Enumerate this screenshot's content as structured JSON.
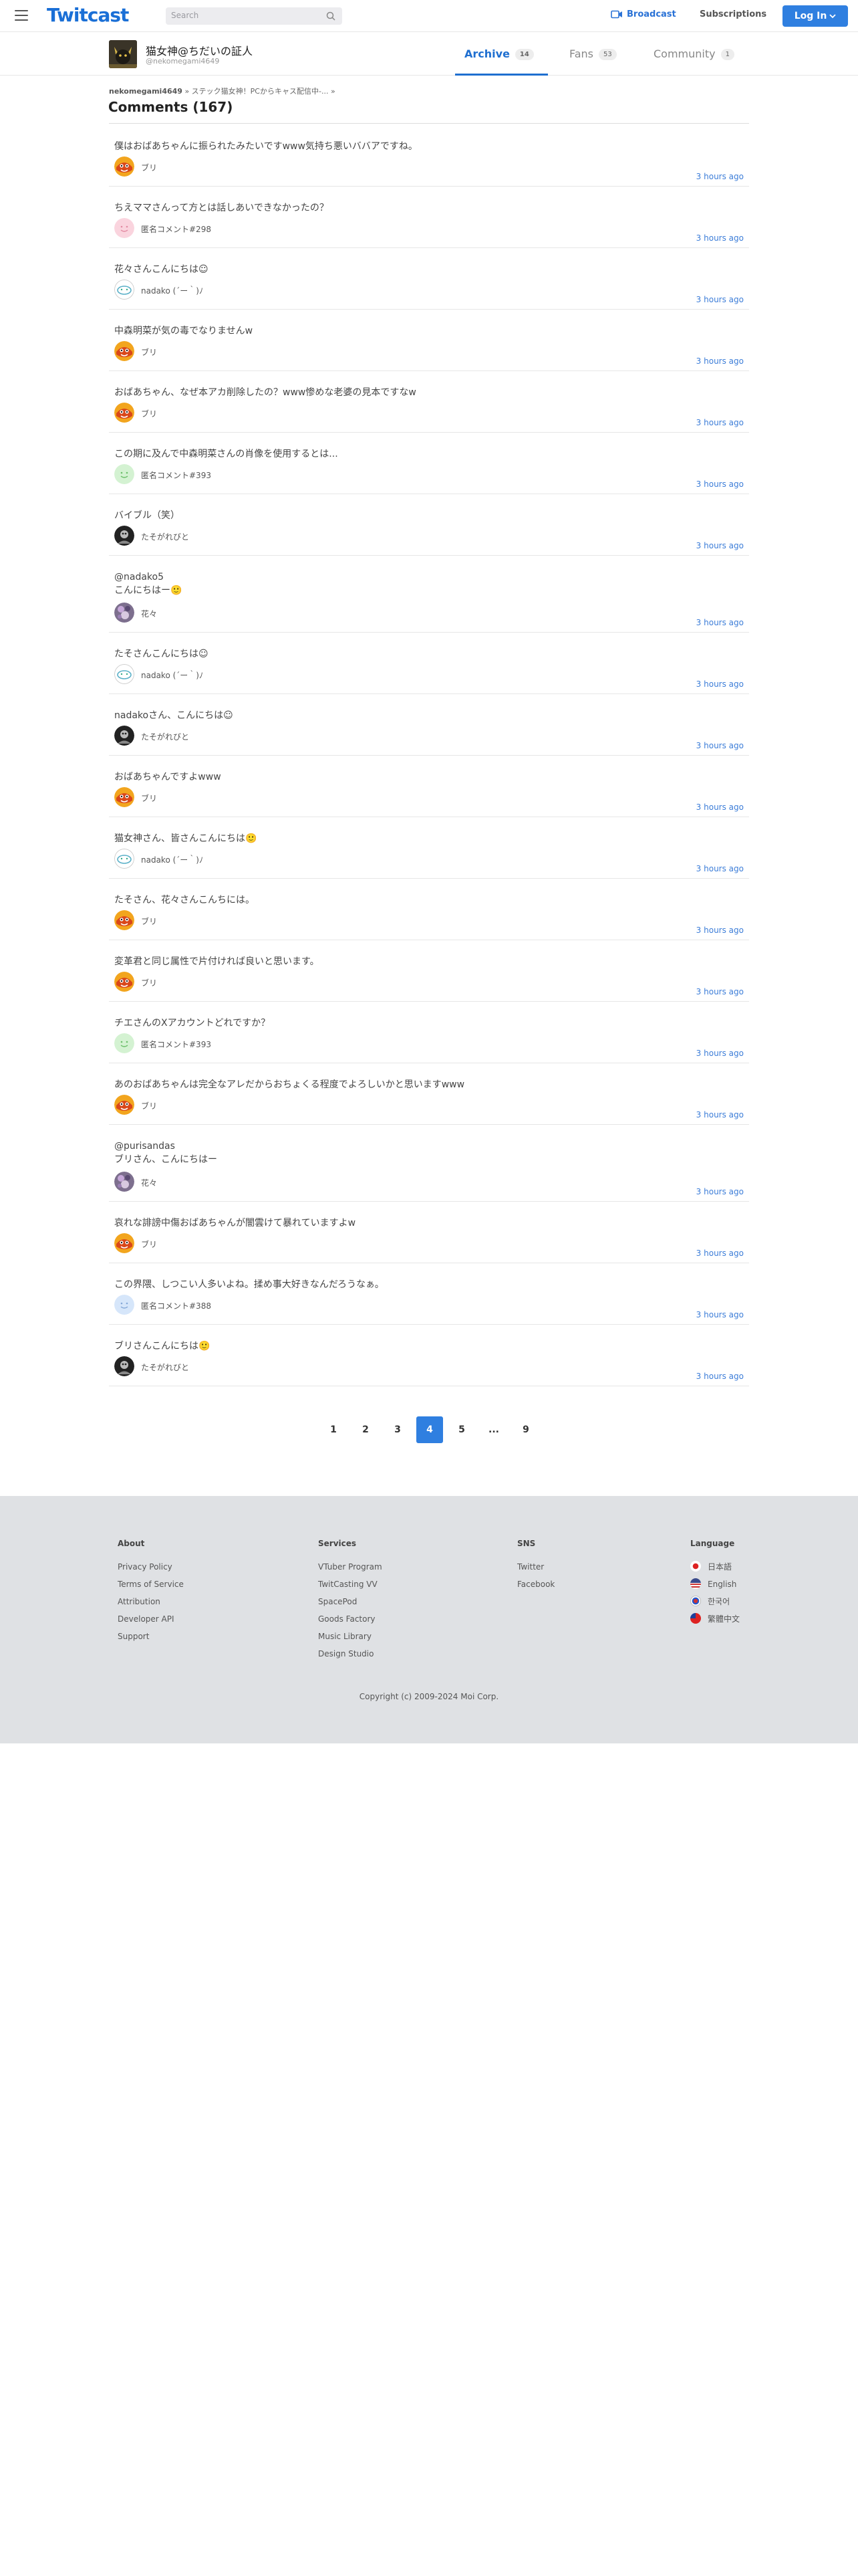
{
  "header": {
    "logo": "Twitcast",
    "search_placeholder": "Search",
    "broadcast_label": "Broadcast",
    "subscriptions_label": "Subscriptions",
    "login_label": "Log In",
    "accent_color": "#2f7fe0"
  },
  "profile": {
    "name": "猫女神@ちだいの証人",
    "handle": "@nekomegami4649",
    "tabs": [
      {
        "label": "Archive",
        "count": "14",
        "active": true
      },
      {
        "label": "Fans",
        "count": "53",
        "active": false
      },
      {
        "label": "Community",
        "count": "1",
        "active": false
      }
    ]
  },
  "breadcrumb": {
    "user": "nekomegami4649",
    "sep": "»",
    "title": "ステック猫女神！PCからキャス配信中-...",
    "arrow": "»"
  },
  "comments_title": "Comments (167)",
  "comments": [
    {
      "text": "僕はおばあちゃんに振られたみたいですwww気持ち悪いババアですね。",
      "user": "ブリ",
      "time": "3 hours ago",
      "avatar": "buri"
    },
    {
      "text": "ちえママさんって方とは話しあいできなかったの？",
      "user": "匿名コメント#298",
      "time": "3 hours ago",
      "avatar": "anon-pink"
    },
    {
      "text": "花々さんこんにちは☺",
      "user": "nadako (´ー｀)ﾉ",
      "time": "3 hours ago",
      "avatar": "nadako"
    },
    {
      "text": "中森明菜が気の毒でなりませんw",
      "user": "ブリ",
      "time": "3 hours ago",
      "avatar": "buri"
    },
    {
      "text": "おばあちゃん、なぜ本アカ削除したの？www惨めな老婆の見本ですなw",
      "user": "ブリ",
      "time": "3 hours ago",
      "avatar": "buri"
    },
    {
      "text": "この期に及んで中森明菜さんの肖像を使用するとは...",
      "user": "匿名コメント#393",
      "time": "3 hours ago",
      "avatar": "anon-green"
    },
    {
      "text": "バイブル（笑）",
      "user": "たそがれびと",
      "time": "3 hours ago",
      "avatar": "taso"
    },
    {
      "text": "@nadako5\nこんにちはー🙂",
      "user": "花々",
      "time": "3 hours ago",
      "avatar": "hana"
    },
    {
      "text": "たそさんこんにちは☺",
      "user": "nadako (´ー｀)ﾉ",
      "time": "3 hours ago",
      "avatar": "nadako"
    },
    {
      "text": "nadakoさん、こんにちは☺",
      "user": "たそがれびと",
      "time": "3 hours ago",
      "avatar": "taso"
    },
    {
      "text": "おばあちゃんですよwww",
      "user": "ブリ",
      "time": "3 hours ago",
      "avatar": "buri"
    },
    {
      "text": "猫女神さん、皆さんこんにちは🙂",
      "user": "nadako (´ー｀)ﾉ",
      "time": "3 hours ago",
      "avatar": "nadako"
    },
    {
      "text": "たそさん、花々さんこんちには。",
      "user": "ブリ",
      "time": "3 hours ago",
      "avatar": "buri"
    },
    {
      "text": "変革君と同じ属性で片付ければ良いと思います。",
      "user": "ブリ",
      "time": "3 hours ago",
      "avatar": "buri"
    },
    {
      "text": "チエさんのXアカウントどれですか？",
      "user": "匿名コメント#393",
      "time": "3 hours ago",
      "avatar": "anon-green"
    },
    {
      "text": "あのおばあちゃんは完全なアレだからおちょくる程度でよろしいかと思いますwww",
      "user": "ブリ",
      "time": "3 hours ago",
      "avatar": "buri"
    },
    {
      "text": "@purisandas\nブリさん、こんにちはー",
      "user": "花々",
      "time": "3 hours ago",
      "avatar": "hana"
    },
    {
      "text": "哀れな誹謗中傷おばあちゃんが闇雲けて暴れていますよw",
      "user": "ブリ",
      "time": "3 hours ago",
      "avatar": "buri"
    },
    {
      "text": "この界隈、しつこい人多いよね。揉め事大好きなんだろうなぁ。",
      "user": "匿名コメント#388",
      "time": "3 hours ago",
      "avatar": "anon-blue"
    },
    {
      "text": "ブリさんこんにちは🙂",
      "user": "たそがれびと",
      "time": "3 hours ago",
      "avatar": "taso"
    }
  ],
  "pagination": [
    "1",
    "2",
    "3",
    "4",
    "5",
    "...",
    "9"
  ],
  "pagination_current": "4",
  "footer": {
    "about": {
      "heading": "About",
      "links": [
        "Privacy Policy",
        "Terms of Service",
        "Attribution",
        "Developer API",
        "Support"
      ]
    },
    "services": {
      "heading": "Services",
      "links": [
        "VTuber Program",
        "TwitCasting VV",
        "SpacePod",
        "Goods Factory",
        "Music Library",
        "Design Studio"
      ]
    },
    "sns": {
      "heading": "SNS",
      "links": [
        "Twitter",
        "Facebook"
      ]
    },
    "language": {
      "heading": "Language",
      "links": [
        "日本語",
        "English",
        "한국어",
        "繁體中文"
      ]
    },
    "copyright": "Copyright (c) 2009-2024 Moi Corp."
  }
}
